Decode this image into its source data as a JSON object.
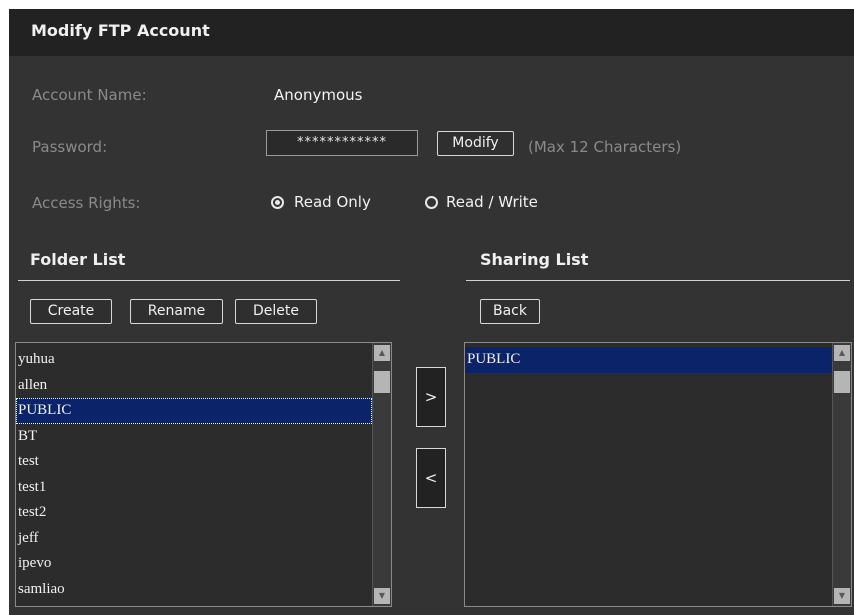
{
  "title": "Modify FTP Account",
  "account": {
    "name_label": "Account Name:",
    "name_value": "Anonymous",
    "password_label": "Password:",
    "password_value": "************",
    "modify_label": "Modify",
    "password_hint": "(Max 12 Characters)",
    "access_label": "Access Rights:",
    "access_options": [
      {
        "label": "Read Only",
        "checked": true
      },
      {
        "label": "Read / Write",
        "checked": false
      }
    ]
  },
  "folder_list": {
    "heading": "Folder List",
    "buttons": {
      "create": "Create",
      "rename": "Rename",
      "delete": "Delete"
    },
    "items": [
      "yuhua",
      "allen",
      "PUBLIC",
      "BT",
      "test",
      "test1",
      "test2",
      "jeff",
      "ipevo",
      "samliao"
    ],
    "selected": "PUBLIC"
  },
  "transfer": {
    "add": ">",
    "remove": "<"
  },
  "sharing_list": {
    "heading": "Sharing List",
    "back_label": "Back",
    "items": [
      "PUBLIC"
    ],
    "selected": "PUBLIC"
  },
  "colors": {
    "panel_bg": "#333333",
    "title_bg": "#222222",
    "selection": "#0b2368",
    "label": "#8a8a8a",
    "text": "#f2f2f2"
  }
}
